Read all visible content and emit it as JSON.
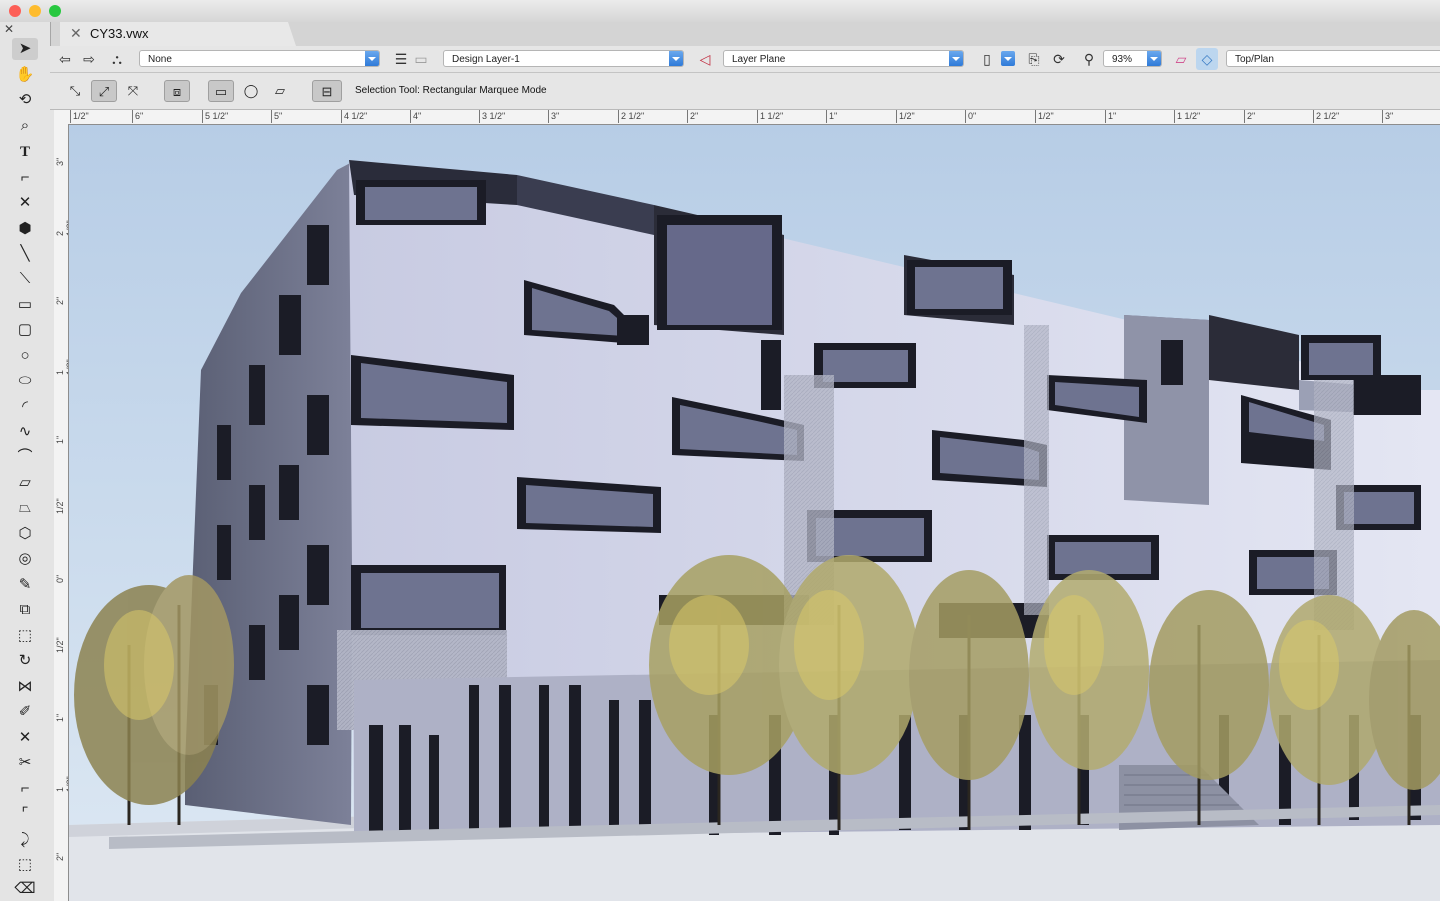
{
  "window": {
    "traffic_colors": [
      "#fd5f57",
      "#febc2e",
      "#28c840"
    ]
  },
  "tab": {
    "filename": "CY33.vwx",
    "close_glyph": "✕"
  },
  "view_bar": {
    "class_value": "None",
    "layer_value": "Design Layer-1",
    "plane_value": "Layer Plane",
    "zoom_value": "93%",
    "view_value": "Top/Plan"
  },
  "mode_bar": {
    "status_text": "Selection Tool: Rectangular Marquee Mode"
  },
  "rulers": {
    "horizontal": [
      "1/2\"",
      "6\"",
      "5 1/2\"",
      "5\"",
      "4 1/2\"",
      "4\"",
      "3 1/2\"",
      "3\"",
      "2 1/2\"",
      "2\"",
      "1 1/2\"",
      "1\"",
      "1/2\"",
      "0\"",
      "1/2\"",
      "1\"",
      "1 1/2\"",
      "2\"",
      "2 1/2\"",
      "3\""
    ],
    "vertical": [
      "3\"",
      "2 1/2\"",
      "2\"",
      "1 1/2\"",
      "1\"",
      "1/2\"",
      "0\"",
      "1/2\"",
      "1\"",
      "1 1/2\"",
      "2\""
    ]
  },
  "icons": {
    "close": "close-icon",
    "back": "arrow-left-icon",
    "forward": "arrow-right-icon",
    "tools": [
      "selection-arrow-icon",
      "pan-hand-icon",
      "flyover-icon",
      "zoom-icon",
      "text-icon",
      "callout-icon",
      "locus-icon",
      "3d-locus-icon",
      "line-icon",
      "double-line-icon",
      "rectangle-icon",
      "rounded-rectangle-icon",
      "circle-icon",
      "oval-icon",
      "arc-icon",
      "freehand-icon",
      "polyline-icon",
      "polygon-icon",
      "double-polygon-icon",
      "regular-polygon-icon",
      "spiral-icon",
      "eyedropper-icon",
      "clip-icon",
      "attribute-mapping-icon",
      "rotate-icon",
      "mirror-icon",
      "reshape-icon",
      "trim-icon",
      "split-icon",
      "fillet-icon",
      "chamfer-icon",
      "offset-icon",
      "visibility-icon",
      "eraser-icon"
    ]
  }
}
